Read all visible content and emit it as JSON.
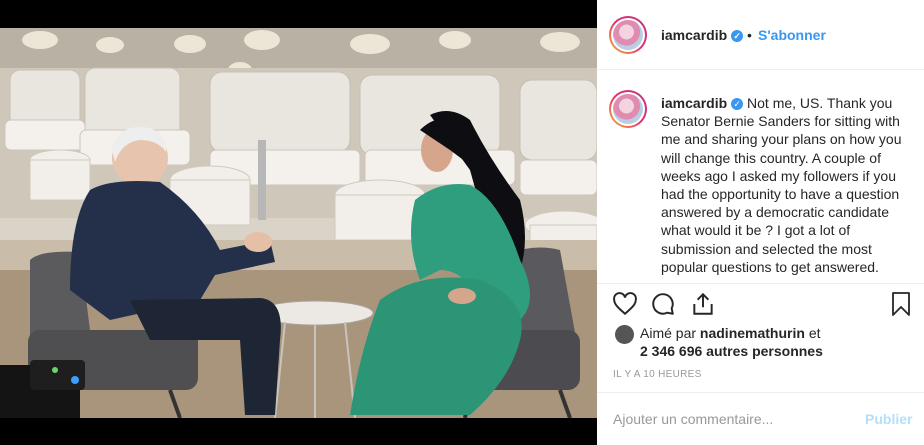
{
  "post": {
    "username": "iamcardib",
    "follow_label": "S'abonner",
    "dot": "•",
    "caption_text": "Not me, US. Thank you Senator Bernie Sanders for sitting with me and sharing your plans on how you will change this country. A couple of weeks ago I asked my followers if you had the opportunity to have a question answered by a democratic candidate what would it be ? I got a lot of submission and selected the most popular questions to get answered.",
    "liked_by_prefix": "Aimé par",
    "liked_by_user": "nadinemathurin",
    "liked_by_suffix": "et",
    "likes_others": "2 346 696 autres personnes",
    "timestamp": "IL Y A 10 HEURES",
    "comment_placeholder": "Ajouter un commentaire...",
    "publish_label": "Publier"
  },
  "icons": {
    "verified": "verified-badge-icon",
    "like": "heart-icon",
    "comment": "comment-icon",
    "share": "share-icon",
    "save": "bookmark-icon"
  },
  "colors": {
    "accent": "#3897f0",
    "publish_disabled": "#b2dffc",
    "dress": "#2f9e7e"
  }
}
